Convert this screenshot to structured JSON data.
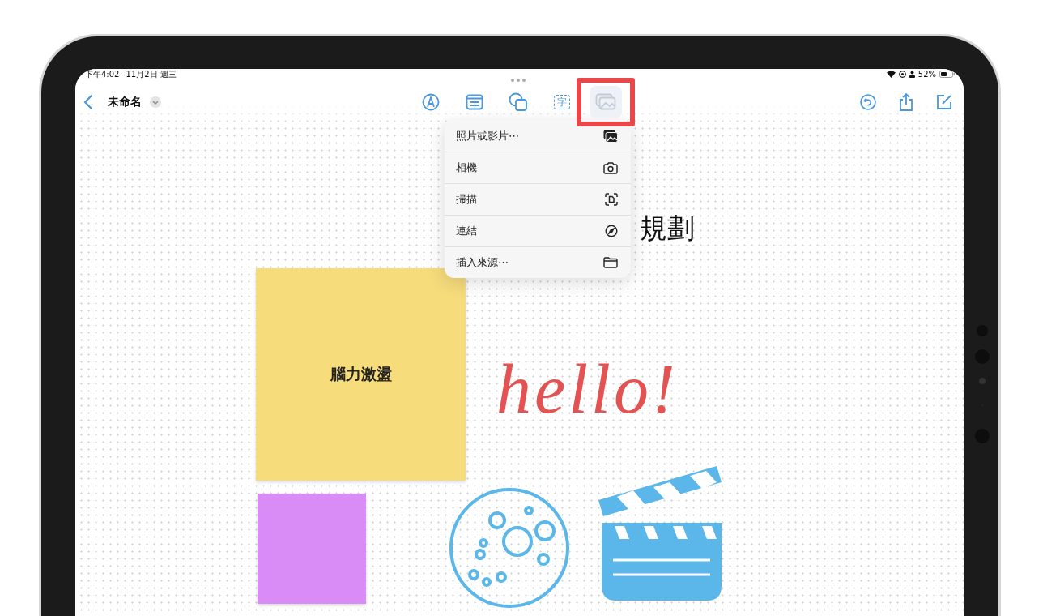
{
  "status_bar": {
    "time": "下午4:02",
    "date": "11月2日 週三",
    "battery": "52%"
  },
  "navigation": {
    "title": "未命名"
  },
  "toolbar": {
    "tools": [
      {
        "selected": false,
        "highlighted": false
      },
      {
        "selected": false,
        "highlighted": false
      },
      {
        "selected": false,
        "highlighted": false
      },
      {
        "glyph": "字",
        "selected": false,
        "highlighted": false
      },
      {
        "selected": true,
        "highlighted": true
      }
    ]
  },
  "insert_menu": {
    "items": [
      {
        "label": "照片或影片⋯"
      },
      {
        "label": "相機"
      },
      {
        "label": "掃描"
      },
      {
        "label": "連結"
      },
      {
        "label": "插入來源⋯"
      }
    ]
  },
  "board": {
    "title": "規劃",
    "sticky_notes": [
      {
        "text": "腦力激盪",
        "color": "#f7dc7c"
      },
      {
        "color": "#d98cf6"
      }
    ],
    "handwriting": {
      "text": "hello!"
    }
  }
}
